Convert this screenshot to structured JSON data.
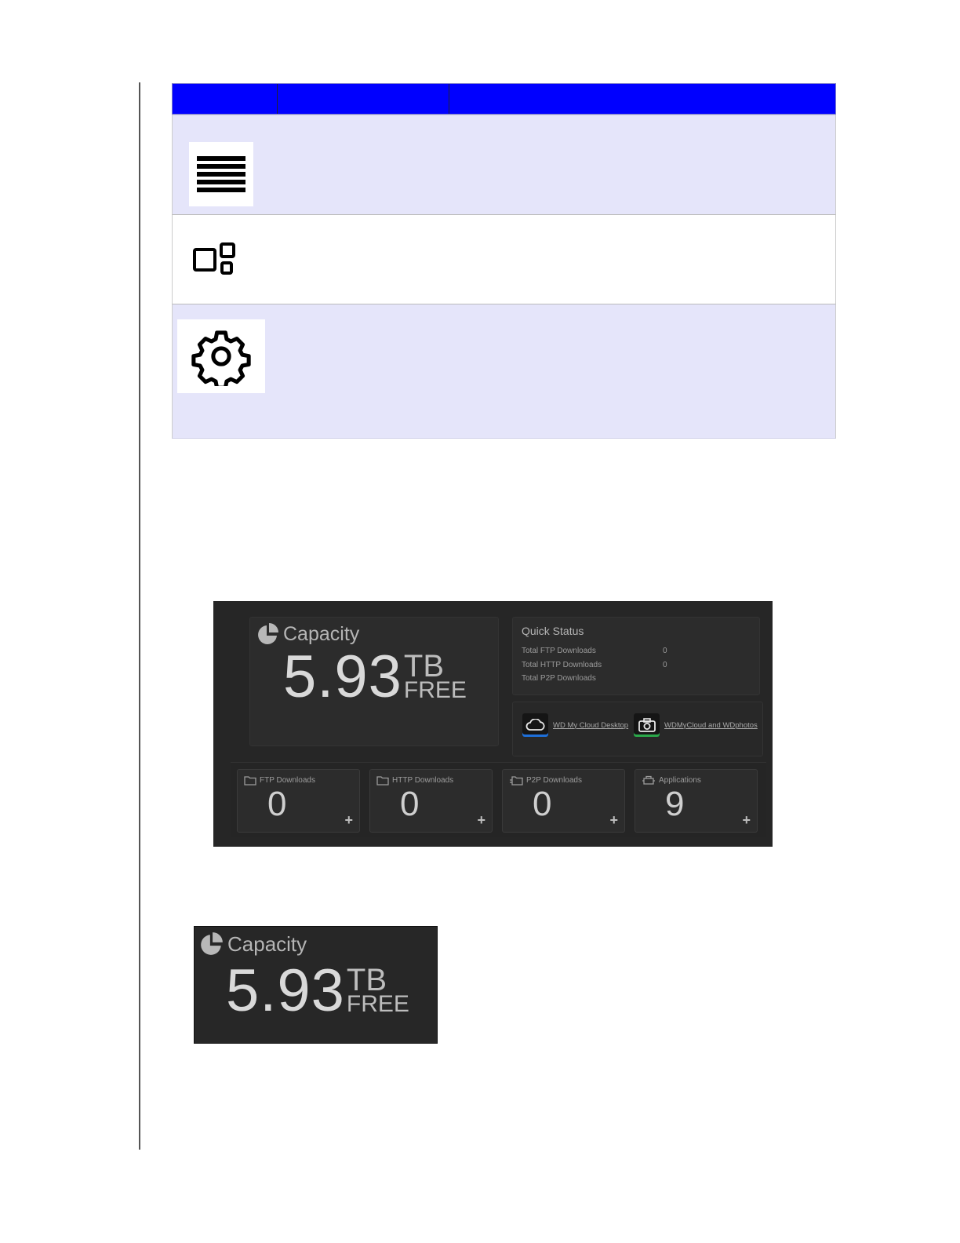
{
  "dashboard": {
    "capacity": {
      "title": "Capacity",
      "value": "5.93",
      "unit": "TB",
      "status": "FREE"
    },
    "quick_status": {
      "title": "Quick Status",
      "rows": [
        {
          "label": "Total FTP Downloads",
          "value": "0"
        },
        {
          "label": "Total HTTP Downloads",
          "value": "0"
        },
        {
          "label": "Total P2P Downloads",
          "value": ""
        }
      ]
    },
    "links": [
      {
        "label": "WD My Cloud Desktop",
        "icon": "cloud-icon",
        "accent": "#1e6fd9"
      },
      {
        "label": "WDMyCloud and WDphotos",
        "icon": "camera-icon",
        "accent": "#2aa84a"
      }
    ],
    "tiles": [
      {
        "label": "FTP Downloads",
        "value": "0",
        "icon": "folder-icon"
      },
      {
        "label": "HTTP Downloads",
        "value": "0",
        "icon": "folder-icon"
      },
      {
        "label": "P2P Downloads",
        "value": "0",
        "icon": "folder-network-icon"
      },
      {
        "label": "Applications",
        "value": "9",
        "icon": "applications-icon"
      }
    ],
    "plus": "+"
  },
  "capacity_crop": {
    "title": "Capacity",
    "value": "5.93",
    "unit": "TB",
    "status": "FREE"
  },
  "icon_table": {
    "header_color": "#0000ff",
    "rows": [
      {
        "icon": "hamburger-menu-icon"
      },
      {
        "icon": "devices-icon"
      },
      {
        "icon": "gear-icon"
      }
    ]
  }
}
